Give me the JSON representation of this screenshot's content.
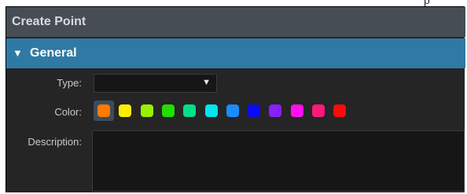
{
  "dialog": {
    "title": "Create Point"
  },
  "section": {
    "label": "General",
    "chevron": "▼"
  },
  "fields": {
    "type": {
      "label": "Type:",
      "value": "",
      "caret": "▼"
    },
    "color": {
      "label": "Color:",
      "selected_index": 0,
      "swatches": [
        "#ff7a00",
        "#ffee00",
        "#99ee00",
        "#22dd00",
        "#00e08a",
        "#00e5f0",
        "#1a8cff",
        "#0a0aff",
        "#8a1fff",
        "#ff10ee",
        "#ff1a7a",
        "#ff0a0a"
      ]
    },
    "description": {
      "label": "Description:",
      "value": ""
    }
  }
}
